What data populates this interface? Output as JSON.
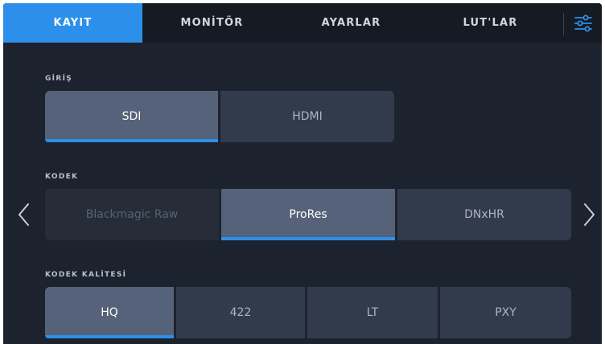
{
  "tabs": [
    {
      "label": "KAYIT",
      "active": true
    },
    {
      "label": "MONİTÖR",
      "active": false
    },
    {
      "label": "AYARLAR",
      "active": false
    },
    {
      "label": "LUT'LAR",
      "active": false
    }
  ],
  "settings_icon": "sliders-icon",
  "input": {
    "label": "GİRİŞ",
    "options": [
      "SDI",
      "HDMI"
    ],
    "selected": "SDI"
  },
  "codec": {
    "label": "KODEK",
    "options": [
      "Blackmagic Raw",
      "ProRes",
      "DNxHR"
    ],
    "selected": "ProRes",
    "disabled": [
      "Blackmagic Raw"
    ]
  },
  "quality": {
    "label": "KODEK KALİTESİ",
    "options": [
      "HQ",
      "422",
      "LT",
      "PXY"
    ],
    "selected": "HQ"
  },
  "nav": {
    "prev_icon": "chevron-left-icon",
    "next_icon": "chevron-right-icon"
  },
  "colors": {
    "accent": "#2c90ea",
    "background": "#1d232e",
    "tabbar": "#161b23",
    "segment": "#323b4b",
    "segment_selected": "#566279"
  }
}
